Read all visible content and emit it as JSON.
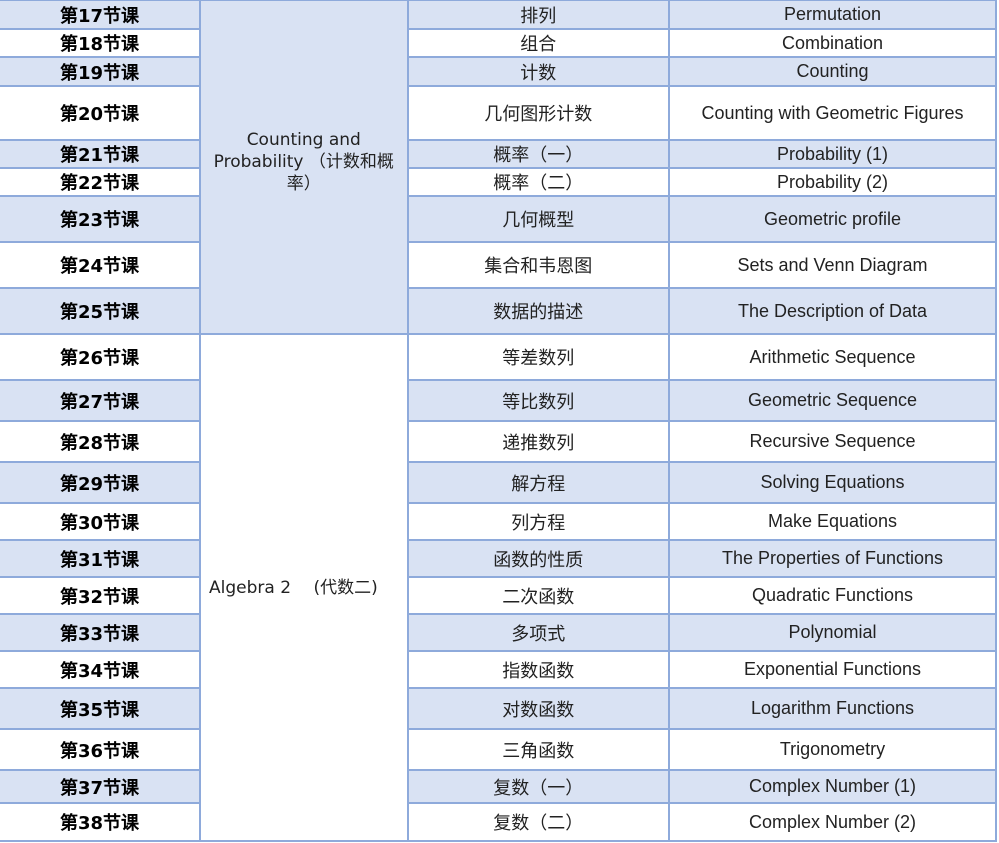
{
  "table": {
    "groups": [
      {
        "label": "Counting and Probability （计数和概率）",
        "rowspan": 9,
        "shade": true
      },
      {
        "label": "Algebra 2　 (代数二)",
        "rowspan": 13,
        "shade": false
      }
    ],
    "rows": [
      {
        "lesson": "第17节课",
        "zh": "排列",
        "en": "Permutation"
      },
      {
        "lesson": "第18节课",
        "zh": "组合",
        "en": "Combination"
      },
      {
        "lesson": "第19节课",
        "zh": "计数",
        "en": "Counting"
      },
      {
        "lesson": "第20节课",
        "zh": "几何图形计数",
        "en": "Counting with Geometric Figures"
      },
      {
        "lesson": "第21节课",
        "zh": "概率（一）",
        "en": "Probability (1)"
      },
      {
        "lesson": "第22节课",
        "zh": "概率（二）",
        "en": "Probability (2)"
      },
      {
        "lesson": "第23节课",
        "zh": "几何概型",
        "en": "Geometric profile"
      },
      {
        "lesson": "第24节课",
        "zh": "集合和韦恩图",
        "en": "Sets and Venn Diagram"
      },
      {
        "lesson": "第25节课",
        "zh": "数据的描述",
        "en": "The Description of Data"
      },
      {
        "lesson": "第26节课",
        "zh": "等差数列",
        "en": "Arithmetic Sequence"
      },
      {
        "lesson": "第27节课",
        "zh": "等比数列",
        "en": "Geometric Sequence"
      },
      {
        "lesson": "第28节课",
        "zh": "递推数列",
        "en": "Recursive Sequence"
      },
      {
        "lesson": "第29节课",
        "zh": "解方程",
        "en": "Solving Equations"
      },
      {
        "lesson": "第30节课",
        "zh": "列方程",
        "en": "Make Equations"
      },
      {
        "lesson": "第31节课",
        "zh": "函数的性质",
        "en": "The Properties of Functions"
      },
      {
        "lesson": "第32节课",
        "zh": "二次函数",
        "en": "Quadratic Functions"
      },
      {
        "lesson": "第33节课",
        "zh": "多项式",
        "en": "Polynomial"
      },
      {
        "lesson": "第34节课",
        "zh": "指数函数",
        "en": "Exponential Functions"
      },
      {
        "lesson": "第35节课",
        "zh": "对数函数",
        "en": "Logarithm Functions"
      },
      {
        "lesson": "第36节课",
        "zh": "三角函数",
        "en": "Trigonometry"
      },
      {
        "lesson": "第37节课",
        "zh": "复数（一）",
        "en": "Complex Number (1)"
      },
      {
        "lesson": "第38节课",
        "zh": "复数（二）",
        "en": "Complex Number (2)"
      }
    ]
  }
}
